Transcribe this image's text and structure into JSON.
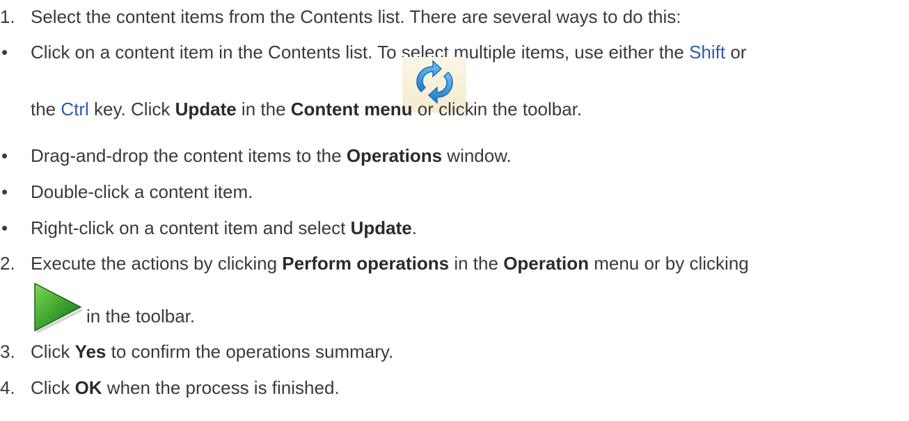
{
  "steps": {
    "s1": {
      "num": "1.",
      "text": "Select the content items from the Contents list. There are several ways to do this:"
    },
    "b1": {
      "bullet": "•",
      "a": "Click on a content item in the Contents list. To select multiple items, use either the ",
      "shift": "Shift",
      "b": " or",
      "c": "the ",
      "ctrl": "Ctrl",
      "d": " key. Click ",
      "update": "Update",
      "e": " in the ",
      "content_menu": "Content menu",
      "f": " or click",
      "g": "in the toolbar."
    },
    "b2": {
      "bullet": "•",
      "a": "Drag-and-drop the content items to the ",
      "operations": "Operations",
      "b": " window."
    },
    "b3": {
      "bullet": "•",
      "a": "Double-click a content item."
    },
    "b4": {
      "bullet": "•",
      "a": "Right-click on a content item and select ",
      "update": "Update",
      "b": "."
    },
    "s2": {
      "num": "2.",
      "a": "Execute the actions by clicking ",
      "perform": "Perform operations",
      "b": " in the ",
      "operation": "Operation",
      "c": " menu or by clicking",
      "d": "in the toolbar."
    },
    "s3": {
      "num": "3.",
      "a": "Click ",
      "yes": "Yes",
      "b": " to confirm the operations summary."
    },
    "s4": {
      "num": "4.",
      "a": "Click ",
      "ok": "OK",
      "b": " when the process is finished."
    }
  },
  "icons": {
    "update": "update-refresh-icon",
    "perform": "play-perform-icon"
  },
  "colors": {
    "text": "#3a3a3a",
    "link": "#2e5aa8",
    "update_icon_blue": "#2f8fd6",
    "play_icon_green": "#3ea52f"
  }
}
